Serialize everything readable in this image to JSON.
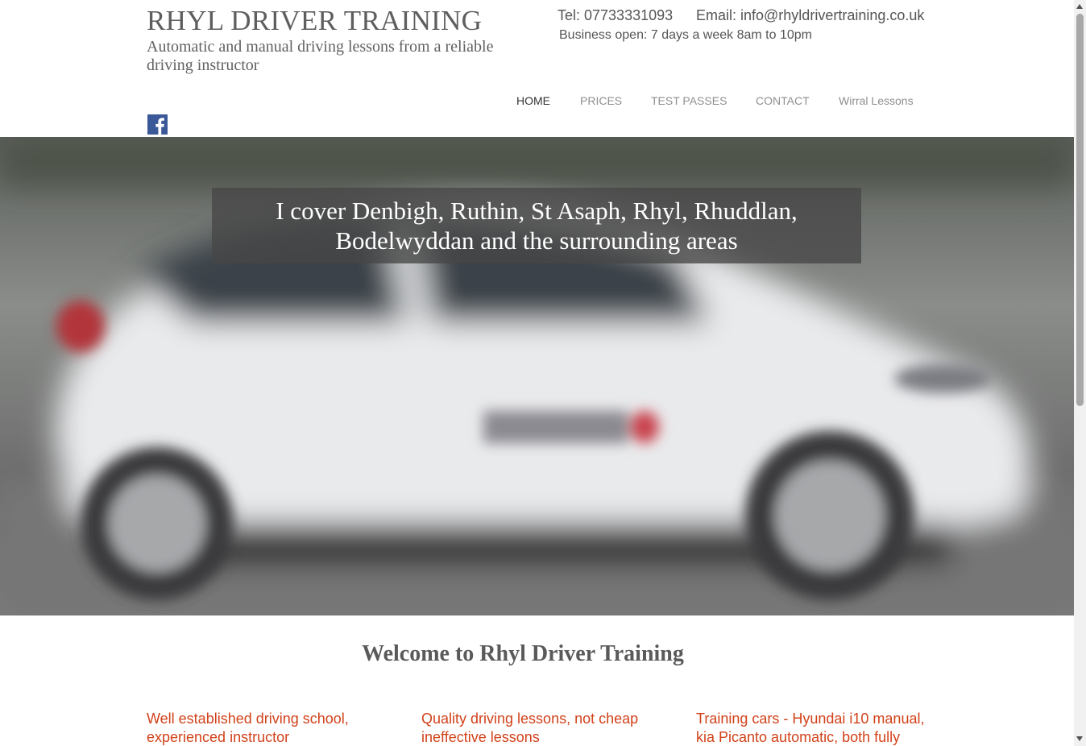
{
  "header": {
    "title": "RHYL DRIVER TRAINING",
    "tagline": "Automatic and manual driving lessons from a reliable driving instructor",
    "tel": "Tel: 07733331093",
    "email": "Email: info@rhyldrivertraining.co.uk",
    "hours": "Business open: 7 days a week 8am to 10pm"
  },
  "nav": {
    "items": [
      {
        "label": "HOME",
        "active": true
      },
      {
        "label": "PRICES",
        "active": false
      },
      {
        "label": "TEST PASSES",
        "active": false
      },
      {
        "label": "CONTACT",
        "active": false
      },
      {
        "label": "Wirral Lessons",
        "active": false
      }
    ]
  },
  "social": {
    "icon": "facebook-icon",
    "color": "#3b5998"
  },
  "hero": {
    "caption": "I cover Denbigh, Ruthin, St Asaph, Rhyl, Rhuddlan, Bodelwyddan and the surrounding areas"
  },
  "main": {
    "welcome": "Welcome to Rhyl Driver Training",
    "features": [
      "Well established driving school, experienced instructor",
      "Quality driving lessons, not cheap ineffective lessons",
      "Training cars - Hyundai i10 manual, kia Picanto automatic, both fully"
    ]
  },
  "colors": {
    "accent": "#d2421a",
    "title_text": "#5e5e5e",
    "nav_active": "#333333",
    "nav_inactive": "#8f8f8f"
  }
}
